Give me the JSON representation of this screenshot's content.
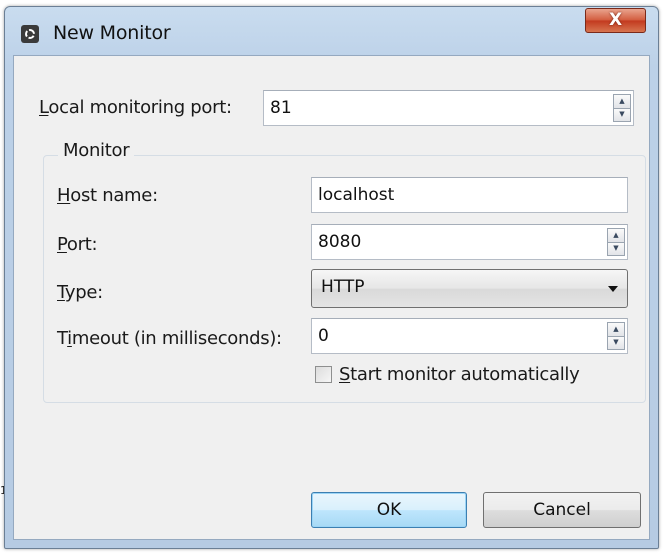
{
  "window": {
    "title": "New Monitor",
    "icon": "eclipse-gear-icon",
    "close_glyph": "X"
  },
  "stray_text": "1",
  "local_port": {
    "label_mnemonic": "L",
    "label_rest": "ocal monitoring port:",
    "value": "81"
  },
  "monitor_group": {
    "title": "Monitor",
    "host": {
      "label_mnemonic": "H",
      "label_rest": "ost name:",
      "value": "localhost"
    },
    "port": {
      "label_mnemonic": "P",
      "label_rest": "ort:",
      "value": "8080"
    },
    "type": {
      "label_mnemonic": "T",
      "label_rest": "ype:",
      "selected": "HTTP"
    },
    "timeout": {
      "label_pre": "T",
      "label_mnemonic": "i",
      "label_rest": "meout (in milliseconds):",
      "value": "0"
    },
    "auto_start": {
      "label_mnemonic": "S",
      "label_rest": "tart monitor automatically",
      "checked": false
    }
  },
  "buttons": {
    "ok": "OK",
    "cancel": "Cancel"
  },
  "spinner_glyphs": {
    "up": "▲",
    "down": "▼"
  }
}
